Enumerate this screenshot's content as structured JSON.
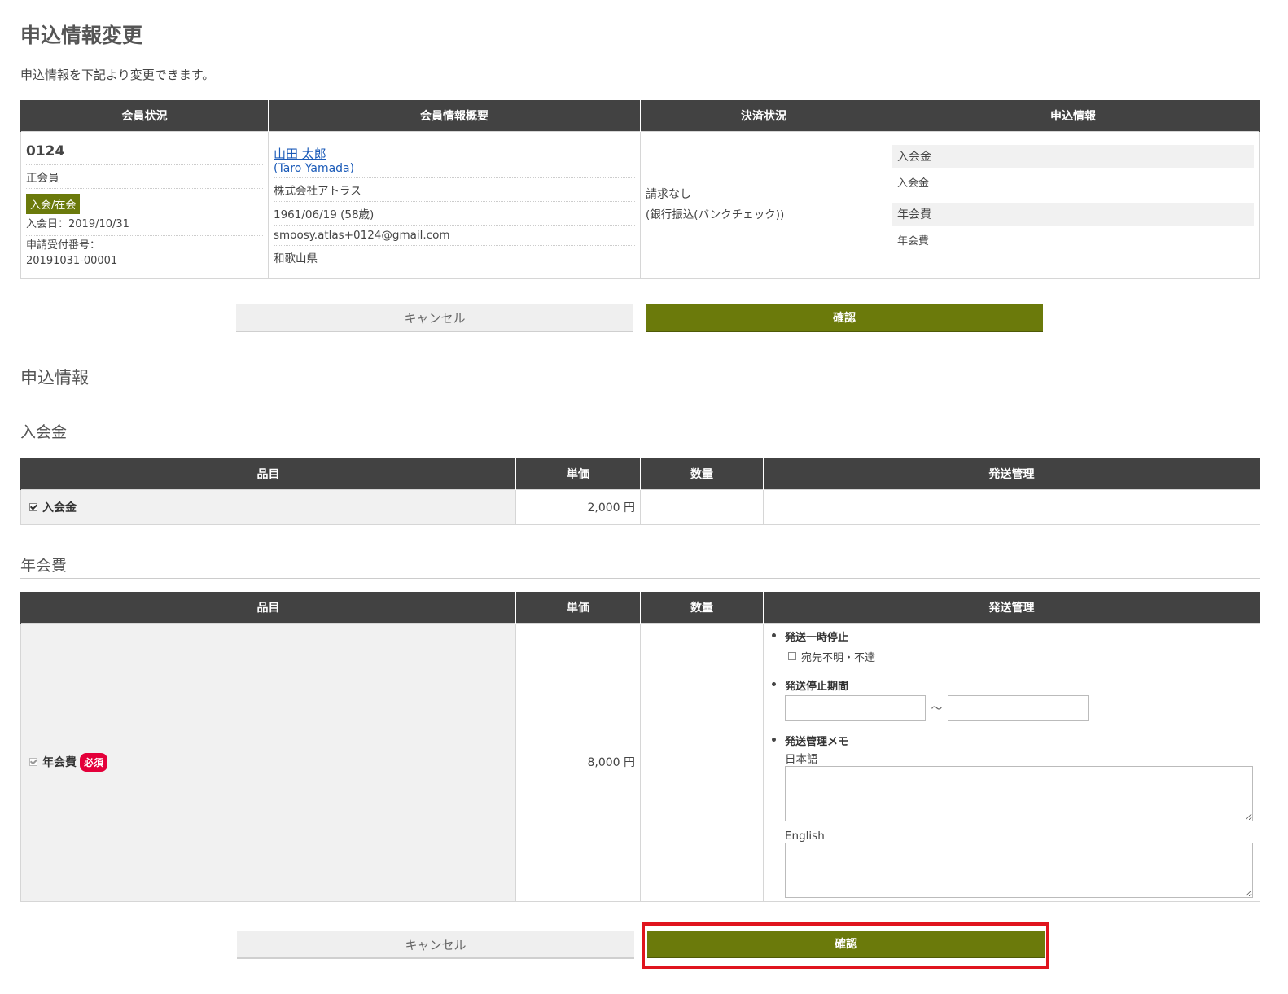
{
  "page": {
    "title": "申込情報変更",
    "description": "申込情報を下記より変更できます。"
  },
  "summary": {
    "headers": [
      "会員状況",
      "会員情報概要",
      "決済状況",
      "申込情報"
    ],
    "member_status": {
      "number": "0124",
      "type": "正会員",
      "status_badge": "入会/在会",
      "join_date": "入会日：2019/10/31",
      "application_no_label": "申請受付番号：",
      "application_no": "20191031-00001"
    },
    "member_info": {
      "name": "山田 太郎",
      "name_en": "(Taro Yamada)",
      "company": "株式会社アトラス",
      "birth": "1961/06/19 (58歳)",
      "email": "smoosy.atlas+0124@gmail.com",
      "prefecture": "和歌山県"
    },
    "payment": {
      "status": "請求なし",
      "method": "(銀行振込(バンクチェック))"
    },
    "application": {
      "groups": [
        {
          "title": "入会金",
          "value": "入会金"
        },
        {
          "title": "年会費",
          "value": "年会費"
        }
      ]
    }
  },
  "buttons": {
    "cancel": "キャンセル",
    "confirm": "確認"
  },
  "section": {
    "title": "申込情報"
  },
  "table_headers": {
    "item": "品目",
    "unit_price": "単価",
    "quantity": "数量",
    "shipping": "発送管理"
  },
  "entrance_fee": {
    "title": "入会金",
    "item_name": "入会金",
    "price": "2,000 円"
  },
  "annual_fee": {
    "title": "年会費",
    "item_name": "年会費",
    "required_badge": "必須",
    "price": "8,000 円",
    "shipping": {
      "pause_label": "発送一時停止",
      "pause_option": "宛先不明・不達",
      "period_label": "発送停止期間",
      "period_separator": "〜",
      "memo_label": "発送管理メモ",
      "memo_ja_label": "日本語",
      "memo_en_label": "English"
    }
  },
  "colors": {
    "header_bg": "#424242",
    "accent_olive": "#6b7a0b",
    "required_red": "#e4003a",
    "highlight_red": "#e0141e",
    "link_blue": "#1a5ab8"
  }
}
